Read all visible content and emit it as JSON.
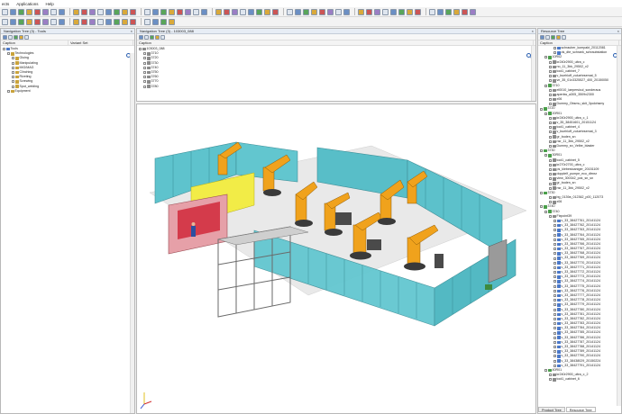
{
  "menu": [
    "ects",
    "Applications",
    "Help"
  ],
  "left_panel": {
    "title": "Navigation Tree (3) - Tools",
    "col_caption": "Caption",
    "col_variant": "Variant Set",
    "tree": [
      {
        "label": "Tools",
        "depth": 0
      },
      {
        "label": "Technologies",
        "depth": 1
      },
      {
        "label": "Gluing",
        "depth": 2
      },
      {
        "label": "Manipulating",
        "depth": 2
      },
      {
        "label": "MIG/MAG",
        "depth": 2
      },
      {
        "label": "Clinching",
        "depth": 2
      },
      {
        "label": "Riveting",
        "depth": 2
      },
      {
        "label": "Screwing",
        "depth": 2
      },
      {
        "label": "Spot_welding",
        "depth": 2
      },
      {
        "label": "Equipment",
        "depth": 1
      }
    ]
  },
  "mid_panel": {
    "title": "Navigation Tree (3) - 103003_088",
    "col_caption": "Caption",
    "tree": [
      {
        "label": "103003_088",
        "depth": 0
      },
      {
        "label": "3710",
        "depth": 1
      },
      {
        "label": "3720",
        "depth": 1
      },
      {
        "label": "3730",
        "depth": 1
      },
      {
        "label": "3740",
        "depth": 1
      },
      {
        "label": "3750",
        "depth": 1
      },
      {
        "label": "3760",
        "depth": 1
      },
      {
        "label": "3770",
        "depth": 1
      },
      {
        "label": "3780",
        "depth": 1
      }
    ]
  },
  "right_panel": {
    "title": "Resource Tree",
    "col_caption": "Caption",
    "tree": [
      {
        "label": "schrauber_kompakt_20112081",
        "depth": 3
      },
      {
        "label": "ds_dte_schrank_schraubstation",
        "depth": 3
      },
      {
        "label": "10R02",
        "depth": 1
      },
      {
        "label": "kr240r2900_ultra_c",
        "depth": 2
      },
      {
        "label": "no_11_3bk_29502_v2",
        "depth": 2
      },
      {
        "label": "tool1_cabinet_7",
        "depth": 2
      },
      {
        "label": "v_buehloff_zuluehrsemat_5",
        "depth": 2
      },
      {
        "label": "vn_35_01x3325527_400_20150050",
        "depth": 2
      },
      {
        "label": "3710",
        "depth": 1
      },
      {
        "label": "el0010_laepersicul_sonderaus",
        "depth": 2
      },
      {
        "label": "aperkw_a305_3509x2300",
        "depth": 2
      },
      {
        "label": "x06",
        "depth": 2
      },
      {
        "label": "Dummy_Obsmu_skit_3polohsmy",
        "depth": 2
      },
      {
        "label": "3720",
        "depth": 0
      },
      {
        "label": "20R01",
        "depth": 1
      },
      {
        "label": "kr240r2900_ultra_c_1",
        "depth": 2
      },
      {
        "label": "v_35_38451601_20151124",
        "depth": 2
      },
      {
        "label": "tool1_cabinet_4",
        "depth": 2
      },
      {
        "label": "v_buehloff_zuluehrsemat_3",
        "depth": 2
      },
      {
        "label": "gr_boden_sn",
        "depth": 2
      },
      {
        "label": "nsr_11_3bk_29502_v2",
        "depth": 2
      },
      {
        "label": "Dummy_sn_Velbe_blaster",
        "depth": 2
      },
      {
        "label": "3730",
        "depth": 0
      },
      {
        "label": "30R01",
        "depth": 1
      },
      {
        "label": "tool1_cabinet_5",
        "depth": 2
      },
      {
        "label": "kr270r2700_ultra_c",
        "depth": 2
      },
      {
        "label": "ps_klebestoaniger_20151109",
        "depth": 2
      },
      {
        "label": "dopplelf_pumpe_eco_dtrnsr",
        "depth": 2
      },
      {
        "label": "view_300342_pok_sn_sn",
        "depth": 2
      },
      {
        "label": "gr_boden_sn",
        "depth": 2
      },
      {
        "label": "nsr_11_3bk_29502_v2",
        "depth": 2
      },
      {
        "label": "3730",
        "depth": 0
      },
      {
        "label": "bg_0139a_012362_p00_112073",
        "depth": 2
      },
      {
        "label": "x06",
        "depth": 2
      },
      {
        "label": "3740",
        "depth": 0
      },
      {
        "label": "3740",
        "depth": 1
      },
      {
        "label": "Fixpoint39",
        "depth": 2
      },
      {
        "label": "v_33_38427761_20141124",
        "depth": 3
      },
      {
        "label": "v_33_38427762_20141124",
        "depth": 3
      },
      {
        "label": "v_33_38427763_20141124",
        "depth": 3
      },
      {
        "label": "v_33_38427764_20141124",
        "depth": 3
      },
      {
        "label": "v_33_38427765_20141124",
        "depth": 3
      },
      {
        "label": "v_33_38427766_20141124",
        "depth": 3
      },
      {
        "label": "v_33_38427767_20141124",
        "depth": 3
      },
      {
        "label": "v_33_38427768_20141124",
        "depth": 3
      },
      {
        "label": "v_33_38427769_20141124",
        "depth": 3
      },
      {
        "label": "v_33_38427770_20141124",
        "depth": 3
      },
      {
        "label": "v_33_38427771_20141124",
        "depth": 3
      },
      {
        "label": "v_33_38427772_20141124",
        "depth": 3
      },
      {
        "label": "v_33_38427773_20141124",
        "depth": 3
      },
      {
        "label": "v_33_38427774_20141124",
        "depth": 3
      },
      {
        "label": "v_33_38427775_20141124",
        "depth": 3
      },
      {
        "label": "v_33_38427776_20141124",
        "depth": 3
      },
      {
        "label": "v_33_38427777_20141124",
        "depth": 3
      },
      {
        "label": "v_33_38427778_20141124",
        "depth": 3
      },
      {
        "label": "v_33_38427779_20141124",
        "depth": 3
      },
      {
        "label": "v_33_38427780_20141124",
        "depth": 3
      },
      {
        "label": "v_33_38427781_20141124",
        "depth": 3
      },
      {
        "label": "v_33_38427782_20141124",
        "depth": 3
      },
      {
        "label": "v_33_38427783_20141124",
        "depth": 3
      },
      {
        "label": "v_33_38427784_20141124",
        "depth": 3
      },
      {
        "label": "v_33_38427785_20141124",
        "depth": 3
      },
      {
        "label": "v_33_38427786_20141124",
        "depth": 3
      },
      {
        "label": "v_33_38427787_20141124",
        "depth": 3
      },
      {
        "label": "v_33_38427788_20141124",
        "depth": 3
      },
      {
        "label": "v_33_38427789_20141124",
        "depth": 3
      },
      {
        "label": "v_33_38427790_20141124",
        "depth": 3
      },
      {
        "label": "v_33_38438029_20150224",
        "depth": 3
      },
      {
        "label": "v_33_38427791_20141124",
        "depth": 3
      },
      {
        "label": "40R01",
        "depth": 1
      },
      {
        "label": "kr240r2900_ultra_c_2",
        "depth": 2
      },
      {
        "label": "tool1_cabinet_6",
        "depth": 2
      }
    ],
    "tabs": [
      "Product Tree",
      "Resource Tree"
    ]
  }
}
